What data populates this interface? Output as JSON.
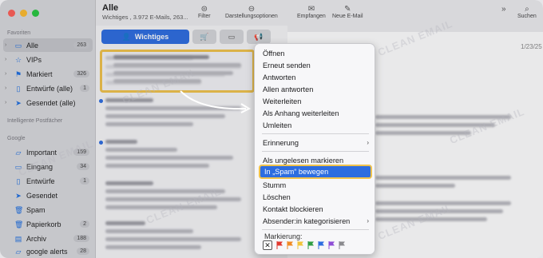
{
  "window": {
    "title": "Alle",
    "subtitle": "Wichtiges , 3.972 E-Mails, 263..."
  },
  "toolbar": {
    "filter": "Filter",
    "display_options": "Darstellungsoptionen",
    "inbox": "Empfangen",
    "new_mail": "Neue E-Mail",
    "search": "Suchen",
    "more": "»"
  },
  "categories": {
    "primary": "Wichtiges"
  },
  "sidebar": {
    "favorites_label": "Favoriten",
    "favorites": [
      {
        "label": "Alle",
        "count": "263",
        "icon": "tray-icon"
      },
      {
        "label": "VIPs",
        "count": "",
        "icon": "star-icon"
      },
      {
        "label": "Markiert",
        "count": "326",
        "icon": "flag-icon"
      },
      {
        "label": "Entwürfe (alle)",
        "count": "1",
        "icon": "document-icon"
      },
      {
        "label": "Gesendet (alle)",
        "count": "",
        "icon": "paperplane-icon"
      }
    ],
    "smart_label": "Intelligente Postfächer",
    "google_label": "Google",
    "google": [
      {
        "label": "Important",
        "count": "159",
        "icon": "folder-icon"
      },
      {
        "label": "Eingang",
        "count": "34",
        "icon": "tray-icon"
      },
      {
        "label": "Entwürfe",
        "count": "1",
        "icon": "document-icon"
      },
      {
        "label": "Gesendet",
        "count": "",
        "icon": "paperplane-icon"
      },
      {
        "label": "Spam",
        "count": "",
        "icon": "trash-icon"
      },
      {
        "label": "Papierkorb",
        "count": "2",
        "icon": "trash-icon"
      },
      {
        "label": "Archiv",
        "count": "188",
        "icon": "archive-icon"
      },
      {
        "label": "google alerts",
        "count": "28",
        "icon": "folder-icon"
      }
    ]
  },
  "reader": {
    "date": "1/23/25"
  },
  "context_menu": {
    "items": [
      "Öffnen",
      "Erneut senden",
      "Antworten",
      "Allen antworten",
      "Weiterleiten",
      "Als Anhang weiterleiten",
      "Umleiten",
      "Erinnerung",
      "Als ungelesen markieren",
      "In „Spam“ bewegen",
      "Stumm",
      "Löschen",
      "Kontakt blockieren",
      "Absender:in kategorisieren"
    ],
    "flag_label": "Markierung:",
    "flag_colors": [
      "#e2392f",
      "#f08a24",
      "#f2c43a",
      "#2f9e44",
      "#2d6de0",
      "#8e4dd6",
      "#8a8a8e"
    ]
  },
  "watermark": "CLEAN EMAIL"
}
